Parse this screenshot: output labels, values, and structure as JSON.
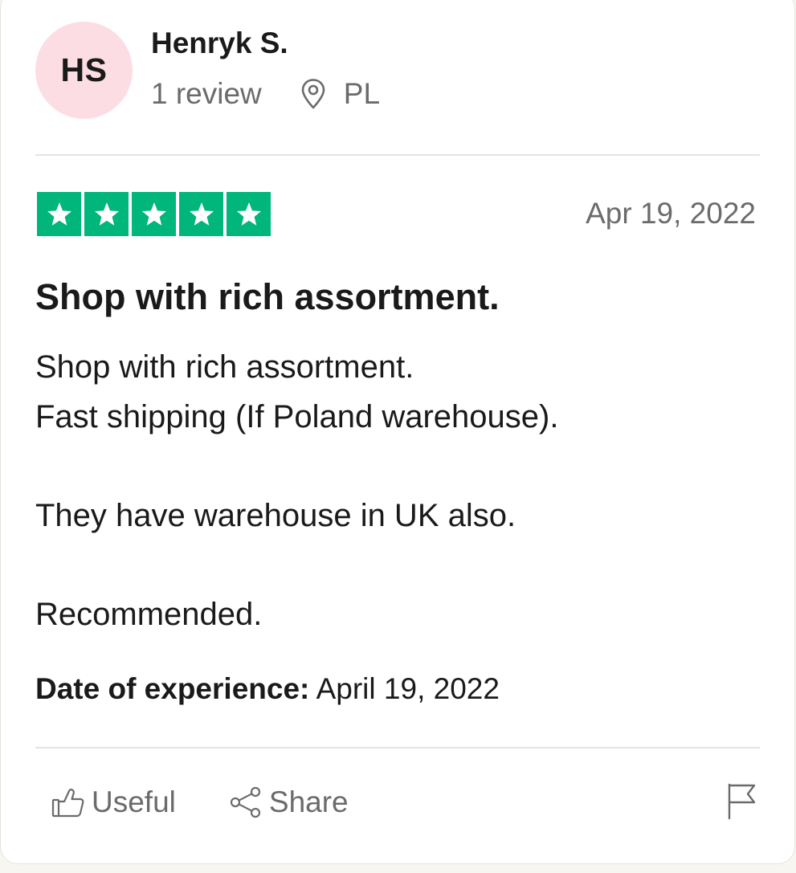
{
  "reviewer": {
    "initials": "HS",
    "name": "Henryk S.",
    "review_count": "1 review",
    "country": "PL",
    "avatar_color": "#fcdde4"
  },
  "review": {
    "rating": 5,
    "rating_max": 5,
    "star_color": "#00b67a",
    "date": "Apr 19, 2022",
    "title": "Shop with rich assortment.",
    "body": {
      "line_1": "Shop with rich assortment.",
      "line_2": "Fast shipping (If Poland warehouse).",
      "line_3": "They have warehouse in UK also.",
      "line_4": "Recommended."
    },
    "experience_label": "Date of experience:",
    "experience_date": "April 19, 2022"
  },
  "actions": {
    "useful_label": "Useful",
    "share_label": "Share",
    "icons": [
      "thumbs-up-icon",
      "share-icon",
      "flag-icon",
      "map-pin-icon",
      "star-icon"
    ]
  }
}
